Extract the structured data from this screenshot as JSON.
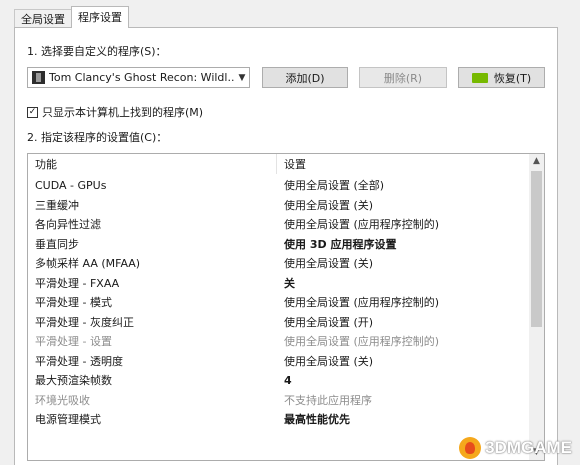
{
  "tabs": [
    {
      "label": "全局设置",
      "active": false
    },
    {
      "label": "程序设置",
      "active": true
    }
  ],
  "section1_label": "1. 选择要自定义的程序(S)：",
  "program_select": {
    "value": "Tom Clancy's Ghost Recon: Wildl..."
  },
  "buttons": {
    "add": "添加(D)",
    "delete": "删除(R)",
    "restore": "恢复(T)"
  },
  "checkbox": {
    "label": "只显示本计算机上找到的程序(M)",
    "checked": true,
    "mark": "✓"
  },
  "section2_label": "2. 指定该程序的设置值(C)：",
  "settings_table": {
    "headers": [
      "功能",
      "设置"
    ],
    "rows": [
      {
        "feature": "CUDA - GPUs",
        "value": "使用全局设置 (全部)",
        "style": "normal"
      },
      {
        "feature": "三重缓冲",
        "value": "使用全局设置 (关)",
        "style": "normal"
      },
      {
        "feature": "各向异性过滤",
        "value": "使用全局设置 (应用程序控制的)",
        "style": "normal"
      },
      {
        "feature": "垂直同步",
        "value": "使用 3D 应用程序设置",
        "style": "bold"
      },
      {
        "feature": "多帧采样 AA (MFAA)",
        "value": "使用全局设置 (关)",
        "style": "normal"
      },
      {
        "feature": "平滑处理 - FXAA",
        "value": "关",
        "style": "bold"
      },
      {
        "feature": "平滑处理 - 模式",
        "value": "使用全局设置 (应用程序控制的)",
        "style": "normal"
      },
      {
        "feature": "平滑处理 - 灰度纠正",
        "value": "使用全局设置 (开)",
        "style": "normal"
      },
      {
        "feature": "平滑处理 - 设置",
        "value": "使用全局设置 (应用程序控制的)",
        "style": "grey"
      },
      {
        "feature": "平滑处理 - 透明度",
        "value": "使用全局设置 (关)",
        "style": "normal"
      },
      {
        "feature": "最大预渲染帧数",
        "value": "4",
        "style": "bold"
      },
      {
        "feature": "环境光吸收",
        "value": "不支持此应用程序",
        "style": "grey"
      },
      {
        "feature": "电源管理模式",
        "value": "最高性能优先",
        "style": "bold"
      }
    ]
  },
  "scroll_position": 0,
  "watermark": {
    "text": "3DMGAME"
  },
  "colors": {
    "nvidia_green": "#76b900"
  }
}
